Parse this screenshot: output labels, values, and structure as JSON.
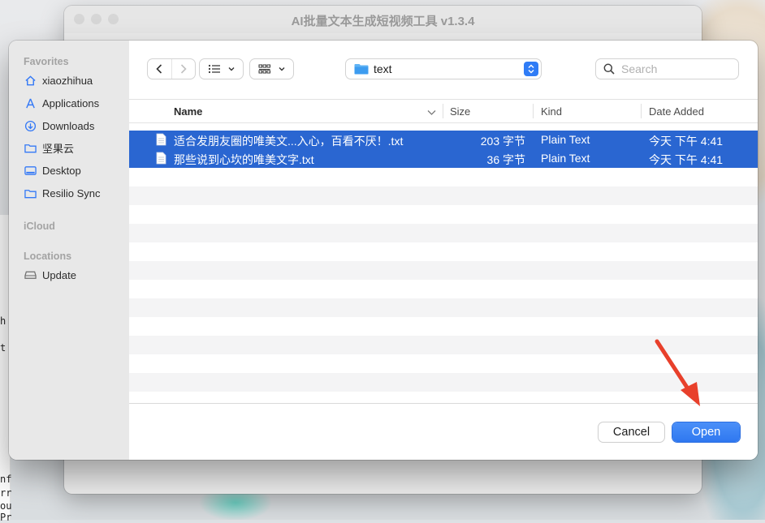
{
  "app": {
    "title": "AI批量文本生成短视频工具 v1.3.4"
  },
  "terminal_fragments": [
    "h",
    "t",
    "nf",
    "rr",
    "ou",
    "Pr"
  ],
  "sidebar": {
    "favorites_header": "Favorites",
    "favorites": [
      {
        "label": "xiaozhihua",
        "icon": "home-icon"
      },
      {
        "label": "Applications",
        "icon": "applications-icon"
      },
      {
        "label": "Downloads",
        "icon": "downloads-icon"
      },
      {
        "label": "坚果云",
        "icon": "folder-icon"
      },
      {
        "label": "Desktop",
        "icon": "desktop-icon"
      },
      {
        "label": "Resilio Sync",
        "icon": "folder-icon"
      }
    ],
    "icloud_header": "iCloud",
    "locations_header": "Locations",
    "locations": [
      {
        "label": "Update",
        "icon": "drive-icon"
      }
    ]
  },
  "toolbar": {
    "path_label": "text",
    "search_placeholder": "Search"
  },
  "file_list": {
    "columns": {
      "name": "Name",
      "size": "Size",
      "kind": "Kind",
      "date_added": "Date Added"
    },
    "rows": [
      {
        "name": "适合发朋友圈的唯美文...入心，百看不厌！.txt",
        "size": "203 字节",
        "kind": "Plain Text",
        "date_added": "今天 下午 4:41",
        "selected": true
      },
      {
        "name": "那些说到心坎的唯美文字.txt",
        "size": "36 字节",
        "kind": "Plain Text",
        "date_added": "今天 下午 4:41",
        "selected": true
      }
    ]
  },
  "buttons": {
    "cancel": "Cancel",
    "open": "Open"
  },
  "colors": {
    "selection": "#2a66d1",
    "accent": "#2f78f0",
    "annotation_arrow": "#e8402b"
  }
}
